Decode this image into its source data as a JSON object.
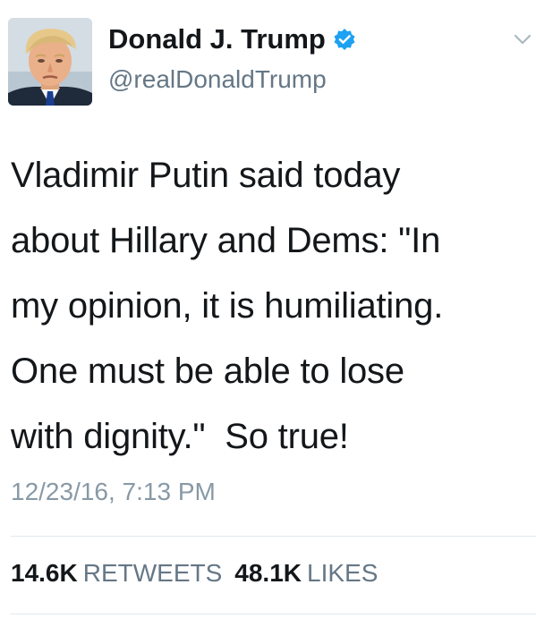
{
  "tweet": {
    "avatar_icon": "profile-photo-avatar",
    "display_name": "Donald J. Trump",
    "verified_icon": "verified-badge-icon",
    "handle": "@realDonaldTrump",
    "menu_icon": "chevron-down-icon",
    "text": "Vladimir Putin said today\nabout Hillary and Dems: \"In\nmy opinion, it is humiliating.\nOne must be able to lose\nwith dignity.\"  So true!",
    "timestamp": "12/23/16, 7:13 PM"
  },
  "stats": {
    "retweets_count": "14.6K",
    "retweets_label": "RETWEETS",
    "likes_count": "48.1K",
    "likes_label": "LIKES"
  },
  "colors": {
    "verified_blue": "#1da1f2",
    "secondary_text": "#657786",
    "timestamp_text": "#8899a6",
    "divider": "#e1e8ed"
  }
}
